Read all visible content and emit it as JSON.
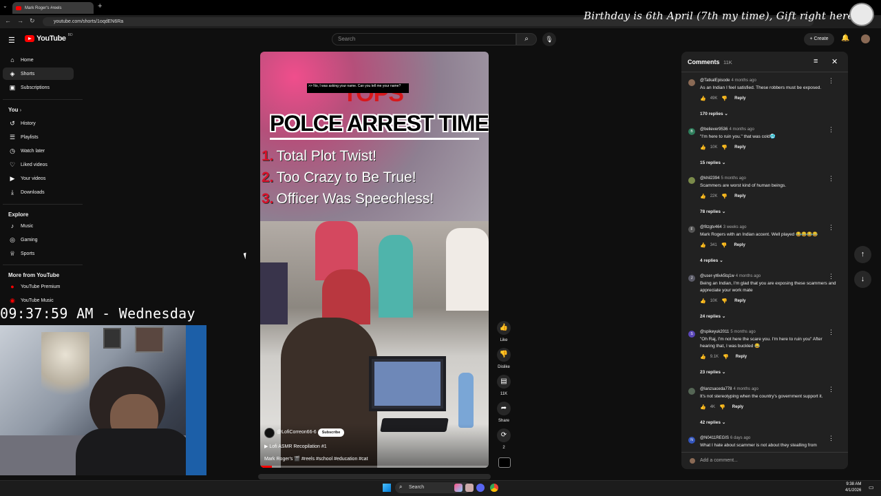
{
  "browser": {
    "tab_title": "Mark Roger's #reels",
    "new_tab_icon": "plus-icon",
    "url": "youtube.com/shorts/1oqdEN6Ra",
    "overlay_text": "Birthday is 6th April (7th my time), Gift right here -"
  },
  "masthead": {
    "logo_text": "YouTube",
    "country_code": "BD",
    "search_placeholder": "Search",
    "create_label": "Create"
  },
  "sidebar": {
    "main": [
      {
        "label": "Home",
        "icon": "home-icon",
        "glyph": "⌂"
      },
      {
        "label": "Shorts",
        "icon": "shorts-icon",
        "glyph": "◈"
      },
      {
        "label": "Subscriptions",
        "icon": "subscriptions-icon",
        "glyph": "▣"
      }
    ],
    "you_label": "You",
    "you": [
      {
        "label": "History",
        "icon": "history-icon",
        "glyph": "↺"
      },
      {
        "label": "Playlists",
        "icon": "playlists-icon",
        "glyph": "☰"
      },
      {
        "label": "Watch later",
        "icon": "watch-later-icon",
        "glyph": "◷"
      },
      {
        "label": "Liked videos",
        "icon": "liked-icon",
        "glyph": "👍"
      },
      {
        "label": "Your videos",
        "icon": "your-videos-icon",
        "glyph": "▶"
      },
      {
        "label": "Downloads",
        "icon": "downloads-icon",
        "glyph": "⤓"
      }
    ],
    "explore_label": "Explore",
    "explore": [
      {
        "label": "Music",
        "icon": "music-icon",
        "glyph": "♪"
      },
      {
        "label": "Gaming",
        "icon": "gaming-icon",
        "glyph": "◎"
      },
      {
        "label": "Sports",
        "icon": "sports-icon",
        "glyph": "♕"
      }
    ],
    "more_label": "More from YouTube",
    "more": [
      {
        "label": "YouTube Premium",
        "icon": "youtube-premium-icon"
      },
      {
        "label": "YouTube Music",
        "icon": "youtube-music-icon"
      }
    ]
  },
  "stream_overlay": {
    "clock": "09:37:59 AM - Wednesday"
  },
  "video": {
    "caption": ">> No, I was asking your name. Can you tell me your name?",
    "tops_text": "TOPS",
    "headline": "POLCE ARREST TIME",
    "items": [
      {
        "num": "1.",
        "text": "Total Plot Twist!"
      },
      {
        "num": "2.",
        "text": "Too Crazy to Be True!"
      },
      {
        "num": "3.",
        "text": "Officer Was Speechless!"
      }
    ],
    "channel": "@LofiCorreon66-6",
    "subscribe_label": "Subscribe",
    "music": "Lofi ASMR Recopilation #1",
    "description": "Mark Roger's 🎬 #reels #school #education #cat",
    "progress": 0.05
  },
  "actions": [
    {
      "name": "like",
      "label": "Like",
      "glyph": "👍"
    },
    {
      "name": "dislike",
      "label": "Dislike",
      "glyph": "👎"
    },
    {
      "name": "comments",
      "label": "11K",
      "glyph": "▤"
    },
    {
      "name": "share",
      "label": "Share",
      "glyph": "➦"
    },
    {
      "name": "remix",
      "label": "2",
      "glyph": "⟳"
    }
  ],
  "comments": {
    "title": "Comments",
    "count": "11K",
    "add_placeholder": "Add a comment...",
    "reply_label": "Reply",
    "items": [
      {
        "user": "@TatkalEpisode",
        "time": "4 months ago",
        "text": "As an Indian I feel satisfied. These robbers must be exposed.",
        "likes": "49K",
        "replies": "170 replies",
        "avatar_color": "#8a6a55",
        "avatar_letter": ""
      },
      {
        "user": "@believer9536",
        "time": "4 months ago",
        "text": "\"I'm here to ruin you.\" that was cold🥶",
        "likes": "10K",
        "replies": "15 replies",
        "avatar_color": "#2e7d5b",
        "avatar_letter": "B"
      },
      {
        "user": "@khil2394",
        "time": "5 months ago",
        "text": "Scammers are worst kind of human beings.",
        "likes": "22K",
        "replies": "78 replies",
        "avatar_color": "#7a8a4a",
        "avatar_letter": ""
      },
      {
        "user": "@fitzgtv464",
        "time": "3 weeks ago",
        "text": "Mark Rogers with an Indian accent. Well played 😂😂😂😂",
        "likes": "341",
        "replies": "4 replies",
        "avatar_color": "#555",
        "avatar_letter": "F"
      },
      {
        "user": "@user-yt6vk5tq1w",
        "time": "4 months ago",
        "text": "Being an Indian, I'm glad that you are exposing these scammers and appreciate your work mate",
        "likes": "10K",
        "replies": "24 replies",
        "avatar_color": "#5a5a66",
        "avatar_letter": "J"
      },
      {
        "user": "@spikeyuk2011",
        "time": "5 months ago",
        "text": "\"Oh Raj, I'm not here the scare you. I'm here to ruin you\" After hearing that, I was buckled 😂",
        "likes": "9.1K",
        "replies": "23 replies",
        "avatar_color": "#5a46b8",
        "avatar_letter": "S"
      },
      {
        "user": "@lanzsaceda778",
        "time": "4 months ago",
        "text": "It's not stereotyping when the country's government support it.",
        "likes": "4K",
        "replies": "42 replies",
        "avatar_color": "#556655",
        "avatar_letter": ""
      },
      {
        "user": "@N0411REGIS",
        "time": "6 days ago",
        "text": "What I hate about scammer is not about they stealling from",
        "likes": "",
        "replies": "",
        "avatar_color": "#3355bb",
        "avatar_letter": "N"
      }
    ]
  },
  "taskbar": {
    "search_label": "Search",
    "time": "9:38 AM",
    "date": "4/1/2026"
  },
  "colors": {
    "background": "#0f0f0f",
    "accent_red": "#ff0000",
    "panel": "#212121"
  }
}
